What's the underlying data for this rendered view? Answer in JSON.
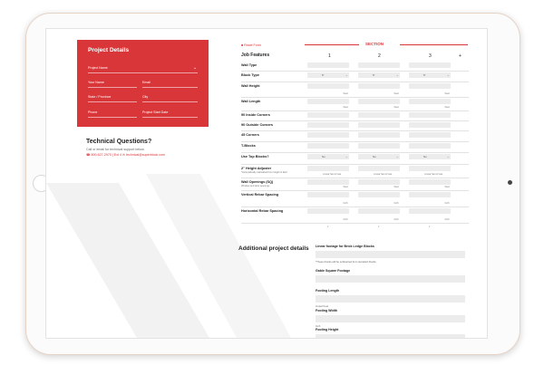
{
  "project_details": {
    "title": "Project Details",
    "fields": {
      "project_name": "Project Name",
      "your_name": "Your Name",
      "email": "Email",
      "state_province": "State / Province",
      "city": "City",
      "phone": "Phone",
      "project_start_date": "Project Start Date"
    }
  },
  "technical": {
    "title": "Technical Questions?",
    "subtitle": "Call or email for technical support below.",
    "phone": "800-627-2970 | Ext 4",
    "email": "technical@superblock.com"
  },
  "section": {
    "reset_label": "Reset Form",
    "label": "SECTION",
    "job_features_title": "Job Features",
    "columns": [
      "1",
      "2",
      "3"
    ],
    "add_label": "+"
  },
  "rows": [
    {
      "label": "Wall Type",
      "sub": "",
      "cell": "",
      "unit": ""
    },
    {
      "label": "Block Type",
      "sub": "",
      "cell": "6\"",
      "unit": ""
    },
    {
      "label": "Wall Height",
      "sub": "",
      "cell": "",
      "unit": "Feet"
    },
    {
      "label": "Wall Length",
      "sub": "",
      "cell": "",
      "unit": "Feet"
    },
    {
      "label": "90 Inside Corners",
      "sub": "",
      "cell": "",
      "unit": ""
    },
    {
      "label": "90 Outside Corners",
      "sub": "",
      "cell": "",
      "unit": ""
    },
    {
      "label": "45 Corners",
      "sub": "",
      "cell": "",
      "unit": ""
    },
    {
      "label": "T-Blocks",
      "sub": "",
      "cell": "",
      "unit": ""
    },
    {
      "label": "Use Top Blocks?",
      "sub": "",
      "cell": "No",
      "unit": ""
    },
    {
      "label": "2\" Height Adjuster",
      "sub": "*Automatically calculated from height & field",
      "cell": "",
      "unit": "Linear feet of use"
    },
    {
      "label": "Wall Openings (SQ)",
      "sub": "Window and door openings",
      "cell": "",
      "unit": "Feet"
    },
    {
      "label": "Vertical Rebar Spacing",
      "sub": "",
      "cell": "",
      "unit": "Inch"
    },
    {
      "label": "Horizontal Rebar Spacing",
      "sub": "",
      "cell": "",
      "unit": "Inch"
    }
  ],
  "row_footer": "x",
  "additional": {
    "title": "Additional project details",
    "items": [
      {
        "label": "Linear footage for Brick Ledge Blocks",
        "note": "*These blocks will be subtracted from standard blocks"
      },
      {
        "label": "Gable Square Footage",
        "note": ""
      },
      {
        "label": "Footing Length",
        "note": "Linear Feet"
      },
      {
        "label": "Footing Width",
        "note": "Inch"
      },
      {
        "label": "Footing Height",
        "note": ""
      }
    ]
  },
  "colors": {
    "accent": "#d9363a"
  }
}
